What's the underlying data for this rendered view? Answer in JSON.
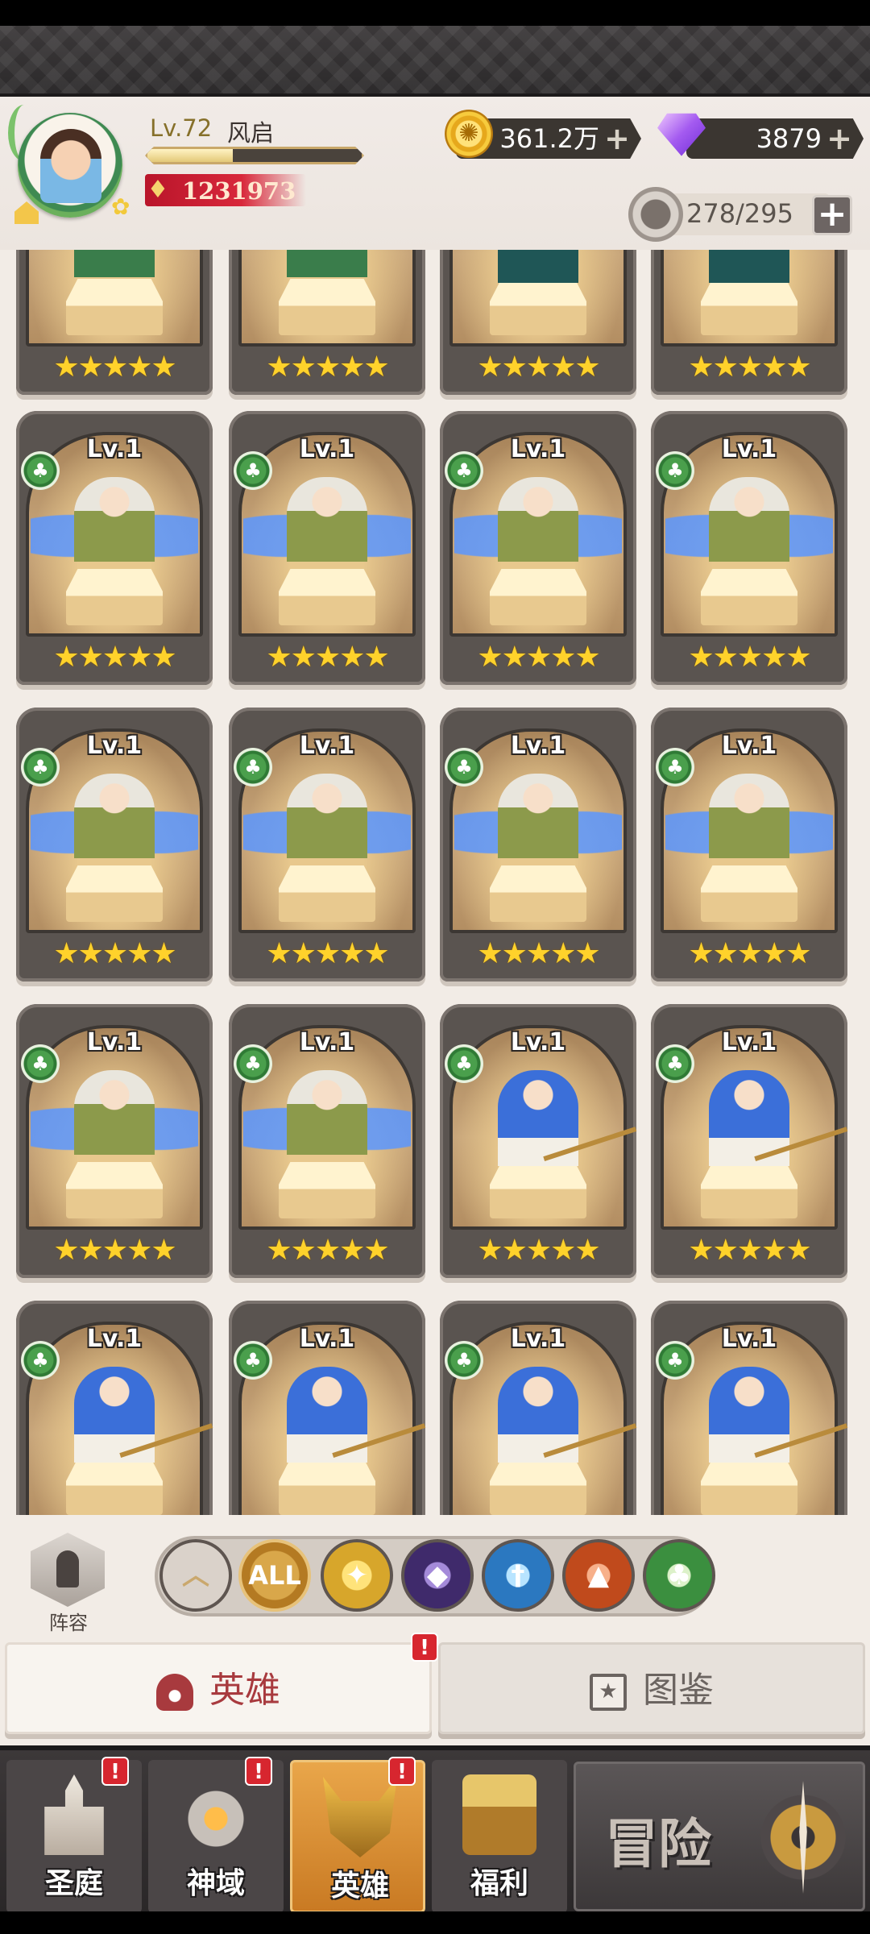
{
  "player": {
    "level_text": "Lv.72",
    "name": "风启",
    "xp_fraction": 0.4,
    "power": "1231973"
  },
  "resources": {
    "gold": "361.2万",
    "gems": "3879",
    "plus": "+"
  },
  "hero_slots": {
    "value": "278/295",
    "plus": "+"
  },
  "hero_grid": {
    "cards": [
      {
        "level": "",
        "hero": "girl",
        "stars": "★★★★★",
        "class_icon": false
      },
      {
        "level": "",
        "hero": "girl",
        "stars": "★★★★★",
        "class_icon": false
      },
      {
        "level": "",
        "hero": "harp",
        "stars": "★★★★★",
        "class_icon": false
      },
      {
        "level": "",
        "hero": "harp",
        "stars": "★★★★★",
        "class_icon": false
      },
      {
        "level": "Lv.1",
        "hero": "fairy",
        "stars": "★★★★★",
        "class_icon": true
      },
      {
        "level": "Lv.1",
        "hero": "fairy",
        "stars": "★★★★★",
        "class_icon": true
      },
      {
        "level": "Lv.1",
        "hero": "fairy",
        "stars": "★★★★★",
        "class_icon": true
      },
      {
        "level": "Lv.1",
        "hero": "fairy",
        "stars": "★★★★★",
        "class_icon": true
      },
      {
        "level": "Lv.1",
        "hero": "fairy",
        "stars": "★★★★★",
        "class_icon": true
      },
      {
        "level": "Lv.1",
        "hero": "fairy",
        "stars": "★★★★★",
        "class_icon": true
      },
      {
        "level": "Lv.1",
        "hero": "fairy",
        "stars": "★★★★★",
        "class_icon": true
      },
      {
        "level": "Lv.1",
        "hero": "fairy",
        "stars": "★★★★★",
        "class_icon": true
      },
      {
        "level": "Lv.1",
        "hero": "fairy",
        "stars": "★★★★★",
        "class_icon": true
      },
      {
        "level": "Lv.1",
        "hero": "fairy",
        "stars": "★★★★★",
        "class_icon": true
      },
      {
        "level": "Lv.1",
        "hero": "mermaid",
        "stars": "★★★★★",
        "class_icon": true
      },
      {
        "level": "Lv.1",
        "hero": "mermaid",
        "stars": "★★★★★",
        "class_icon": true
      },
      {
        "level": "Lv.1",
        "hero": "mermaid",
        "stars": "",
        "class_icon": true
      },
      {
        "level": "Lv.1",
        "hero": "mermaid",
        "stars": "",
        "class_icon": true
      },
      {
        "level": "Lv.1",
        "hero": "mermaid",
        "stars": "",
        "class_icon": true
      },
      {
        "level": "Lv.1",
        "hero": "mermaid",
        "stars": "",
        "class_icon": true
      }
    ]
  },
  "filters": {
    "lineup_label": "阵容",
    "all_label": "ALL",
    "items": [
      "sort-up-icon",
      "all",
      "light-element-icon",
      "dark-element-icon",
      "water-element-icon",
      "fire-element-icon",
      "nature-element-icon"
    ]
  },
  "tabs": {
    "heroes": "英雄",
    "codex": "图鉴",
    "badge": "!"
  },
  "nav": {
    "court": "圣庭",
    "realm": "神域",
    "heroes": "英雄",
    "welfare": "福利",
    "adventure": "冒险",
    "badge": "!"
  }
}
